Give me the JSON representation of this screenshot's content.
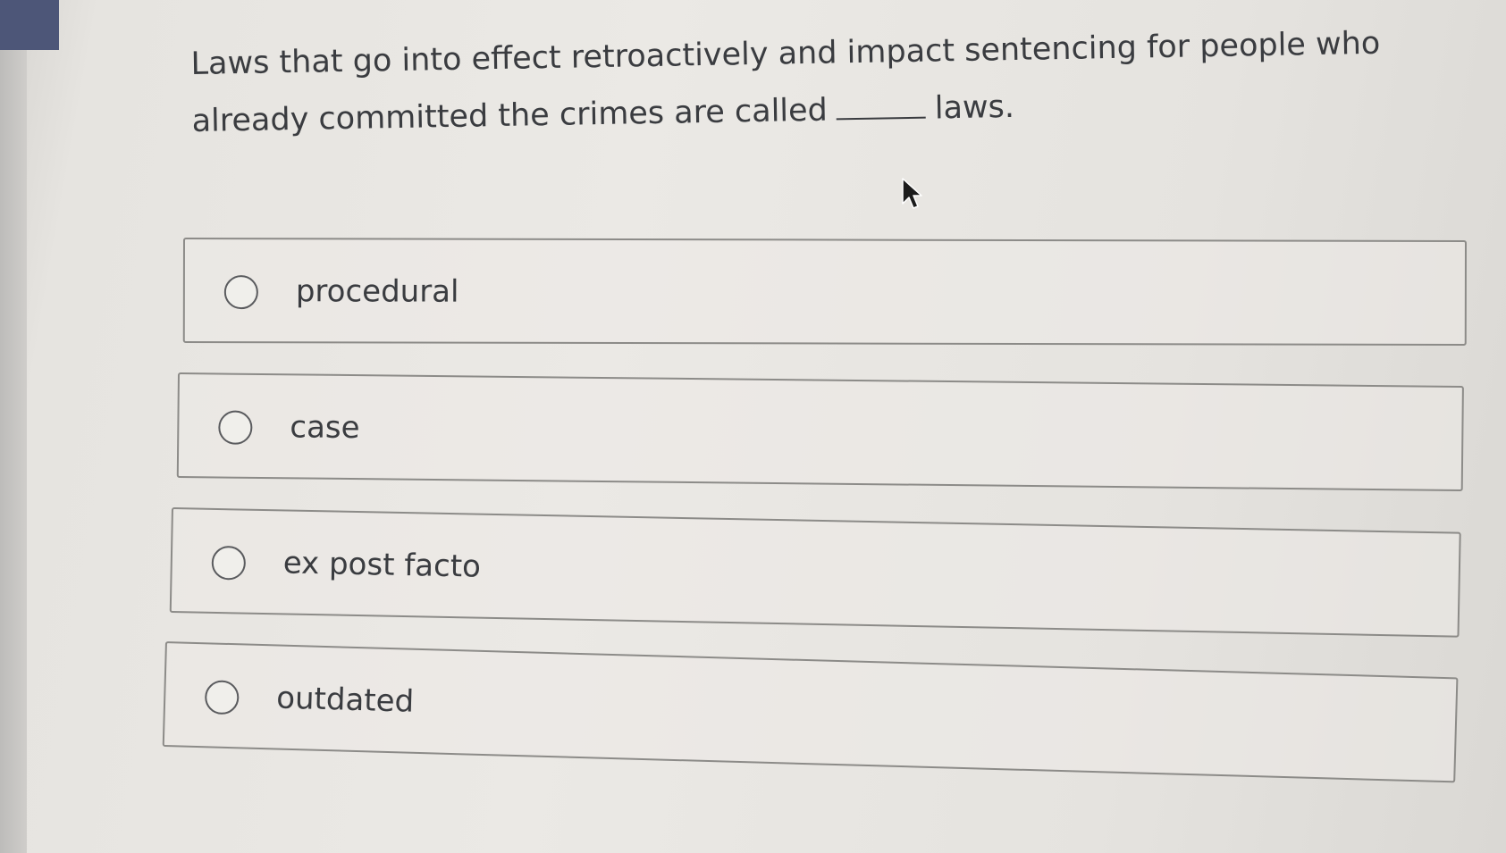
{
  "question": {
    "line1": "Laws that go into effect retroactively and impact sentencing for people who",
    "line2_before": "already committed the crimes are called",
    "line2_after": "laws."
  },
  "options": [
    {
      "label": "procedural",
      "selected": false
    },
    {
      "label": "case",
      "selected": false
    },
    {
      "label": "ex post facto",
      "selected": false
    },
    {
      "label": "outdated",
      "selected": false
    }
  ],
  "icons": {
    "cursor": "arrow-cursor-icon",
    "radio": "radio-unchecked-icon"
  },
  "colors": {
    "corner_tab": "#4d5678",
    "text": "#3a3c40",
    "border": "#8c8b88"
  }
}
